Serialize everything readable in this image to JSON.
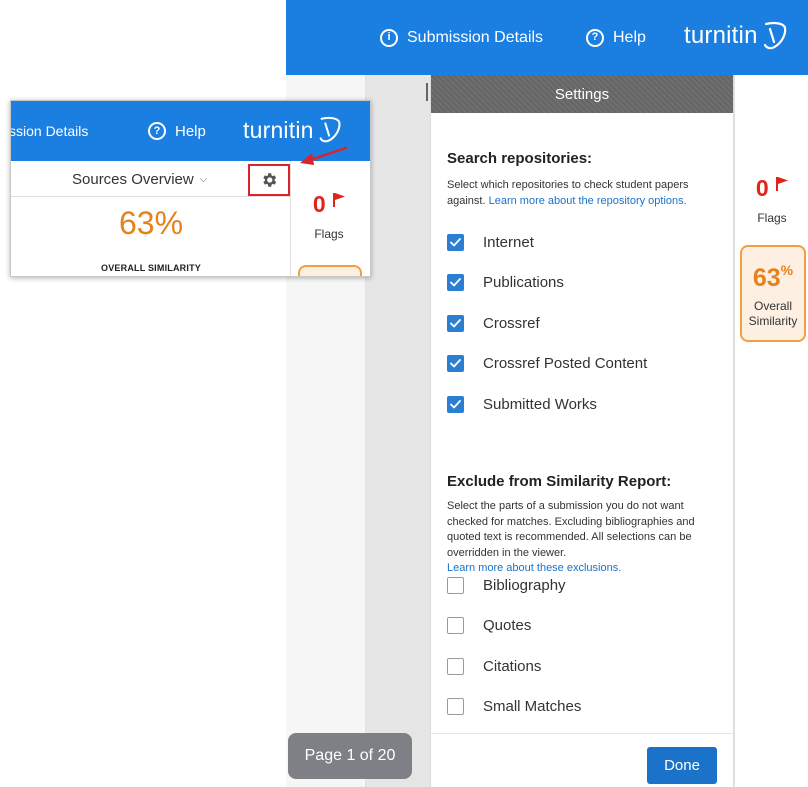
{
  "header": {
    "submission_details": "Submission Details",
    "help": "Help",
    "logo": "turnitin"
  },
  "inset": {
    "submission_details_cropped": "ssion Details",
    "help": "Help",
    "logo": "turnitin",
    "sources_overview": "Sources Overview",
    "similarity_percent": "63%",
    "overall_similarity": "OVERALL SIMILARITY",
    "flags_count": "0",
    "flags_label": "Flags"
  },
  "rail": {
    "flags_count": "0",
    "flags_label": "Flags",
    "similarity_value": "63",
    "similarity_unit": "%",
    "similarity_label_line1": "Overall",
    "similarity_label_line2": "Similarity"
  },
  "pager": {
    "label": "Page 1 of 20"
  },
  "settings": {
    "title": "Settings",
    "search": {
      "heading": "Search repositories:",
      "desc": "Select which repositories to check student papers against.",
      "link": "Learn more about the repository options.",
      "options": [
        {
          "label": "Internet",
          "checked": true
        },
        {
          "label": "Publications",
          "checked": true
        },
        {
          "label": "Crossref",
          "checked": true
        },
        {
          "label": "Crossref Posted Content",
          "checked": true
        },
        {
          "label": "Submitted Works",
          "checked": true
        }
      ]
    },
    "exclude": {
      "heading": "Exclude from Similarity Report:",
      "desc": "Select the parts of a submission you do not want checked for matches. Excluding bibliographies and quoted text is recommended. All selections can be overridden in the viewer.",
      "link": "Learn more about these exclusions.",
      "options": [
        {
          "label": "Bibliography",
          "checked": false
        },
        {
          "label": "Quotes",
          "checked": false
        },
        {
          "label": "Citations",
          "checked": false
        },
        {
          "label": "Small Matches",
          "checked": false
        }
      ]
    },
    "done_label": "Done"
  },
  "colors": {
    "header_blue": "#1a7fe0",
    "checkbox_blue": "#2a7fd2",
    "done_blue": "#1a73c8",
    "flag_red": "#e2231a",
    "similarity_orange": "#e6811c",
    "highlight_red": "#d9232d"
  },
  "icons": [
    "info-icon",
    "help-icon",
    "turnitin-logo-icon",
    "gear-icon",
    "flag-icon",
    "checkmark-icon",
    "chevron-down-icon",
    "arrow-icon"
  ]
}
